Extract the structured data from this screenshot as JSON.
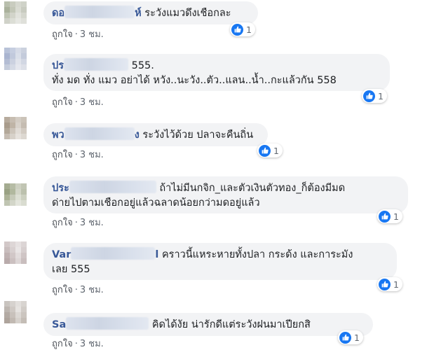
{
  "meta": {
    "like_label": "ถูกใจ",
    "separator": "·"
  },
  "colors": {
    "accent": "#1877f2",
    "name": "#385898",
    "bubble": "#f2f3f5",
    "meta": "#606770"
  },
  "comments": [
    {
      "name_prefix": "ดอ",
      "name_suffix": "ห์",
      "text": "ระวังแมวดึงเชือกละ",
      "likes": "1",
      "time": "3 ชม."
    },
    {
      "name_prefix": "ปร",
      "name_suffix": "",
      "line1": "555.",
      "line2": "ทั่ง มด ทั่ง แมว อย่าได้ หวัง..นะวัง..ตัว..แลน..น้ำ..กะแล้วกัน 558",
      "likes": "1",
      "time": "3 ชม."
    },
    {
      "name_prefix": "พว",
      "name_suffix": "ง",
      "text": "ระวังไว้ด้วย ปลาจะคืนถิ่น",
      "likes": "1",
      "time": "3 ชม."
    },
    {
      "name_prefix": "ประ",
      "name_suffix": "",
      "line1": "ถ้าไม่มีนกจิก_และตัวเงินตัวทอง_ก็ต้องมีมด",
      "line2": "ด่ายไปตามเชือกอยู่แล้วฉลาดน้อยกว่ามดอยู่แล้ว",
      "likes": "1",
      "time": "3 ชม."
    },
    {
      "name_prefix": "Var",
      "name_suffix": "l",
      "line1": "คราวนี้แหระหายทั้งปลา กระด้ง และการะมัง",
      "line2": "เลย 555",
      "likes": "1",
      "time": "3 ชม."
    },
    {
      "name_prefix": "Sa",
      "name_suffix": "",
      "text": "คิดได้งัย น่ารักดีแต่ระวังฝนมาเปียกสิ",
      "likes": "1",
      "time": "3 ชม."
    }
  ]
}
